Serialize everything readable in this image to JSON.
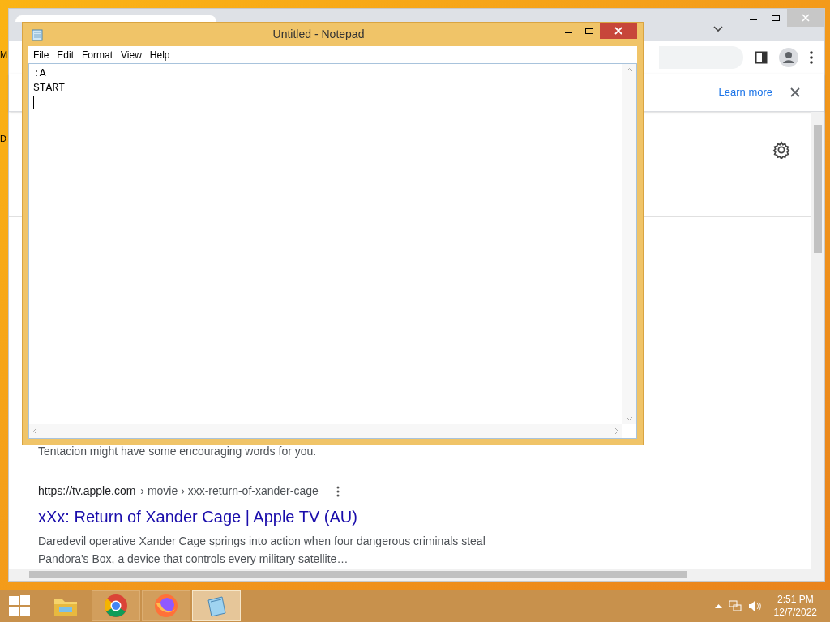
{
  "desktop": {
    "icon_labels": [
      "M",
      "D"
    ]
  },
  "browser": {
    "banner_link": "Learn more",
    "results": [
      {
        "kind": "snippet",
        "snippet": "Tentacion might have some encouraging words for you."
      },
      {
        "kind": "result",
        "url": "https://tv.apple.com",
        "breadcrumb": "› movie › xxx-return-of-xander-cage",
        "title": "xXx: Return of Xander Cage | Apple TV (AU)",
        "snippet": "Daredevil operative Xander Cage springs into action when four dangerous criminals steal Pandora's Box, a device that controls every military satellite…"
      }
    ]
  },
  "notepad": {
    "title": "Untitled - Notepad",
    "menu": [
      "File",
      "Edit",
      "Format",
      "View",
      "Help"
    ],
    "lines": [
      ":A",
      "START"
    ]
  },
  "taskbar": {
    "apps": [
      {
        "kind": "explorer",
        "selected": false
      },
      {
        "kind": "chrome",
        "selected": false
      },
      {
        "kind": "firefox",
        "selected": false
      },
      {
        "kind": "notepad",
        "selected": true
      }
    ],
    "time": "2:51 PM",
    "date": "12/7/2022"
  }
}
